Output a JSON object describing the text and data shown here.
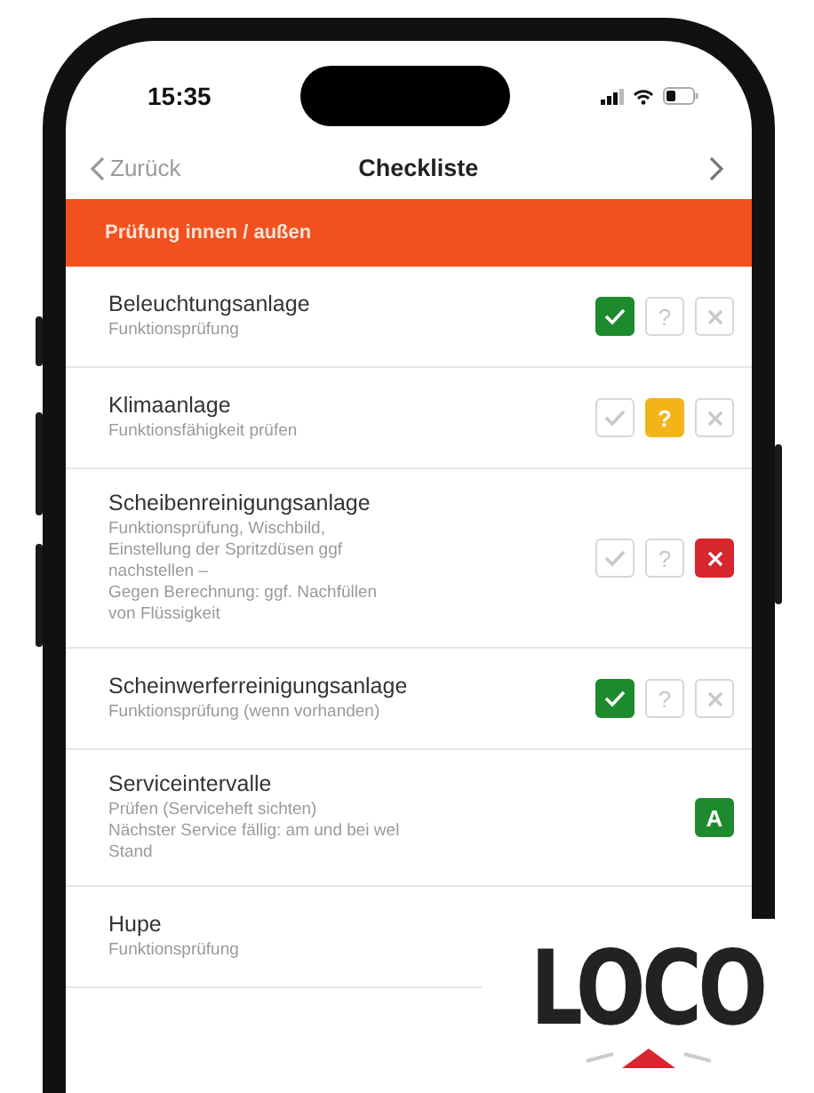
{
  "status_bar": {
    "time": "15:35"
  },
  "nav": {
    "back": "Zurück",
    "title": "Checkliste"
  },
  "section": {
    "title": "Prüfung innen / außen"
  },
  "items": [
    {
      "title": "Beleuchtungsanlage",
      "description": [
        "Funktionsprüfung"
      ],
      "kind": "tristate",
      "options": [
        {
          "kind": "ok",
          "selected": true
        },
        {
          "kind": "unclear",
          "label": "?",
          "selected": false
        },
        {
          "kind": "fail",
          "selected": false
        }
      ]
    },
    {
      "title": "Klimaanlage",
      "description": [
        "Funktionsfähigkeit prüfen"
      ],
      "kind": "tristate",
      "options": [
        {
          "kind": "ok",
          "selected": false
        },
        {
          "kind": "unclear",
          "label": "?",
          "selected": true
        },
        {
          "kind": "fail",
          "selected": false
        }
      ]
    },
    {
      "title": "Scheibenreinigungsanlage",
      "description": [
        "Funktionsprüfung, Wischbild,",
        "Einstellung der Spritzdüsen ggf",
        "nachstellen –",
        "Gegen Berechnung: ggf. Nachfüllen",
        "von Flüssigkeit"
      ],
      "kind": "tristate",
      "options": [
        {
          "kind": "ok",
          "selected": false
        },
        {
          "kind": "unclear",
          "label": "?",
          "selected": false
        },
        {
          "kind": "fail",
          "selected": true
        }
      ]
    },
    {
      "title": "Scheinwerferreinigungsanlage",
      "description": [
        "Funktionsprüfung (wenn vorhanden)"
      ],
      "kind": "tristate",
      "options": [
        {
          "kind": "ok",
          "selected": true
        },
        {
          "kind": "unclear",
          "label": "?",
          "selected": false
        },
        {
          "kind": "fail",
          "selected": false
        }
      ]
    },
    {
      "title": "Serviceintervalle",
      "description": [
        "Prüfen (Serviceheft sichten)",
        "Nächster Service fällig: am und bei wel",
        "Stand"
      ],
      "kind": "grade",
      "grade": "A"
    },
    {
      "title": "Hupe",
      "description": [
        "Funktionsprüfung"
      ],
      "kind": "plain"
    }
  ],
  "logo": {
    "text": "LOCO"
  }
}
